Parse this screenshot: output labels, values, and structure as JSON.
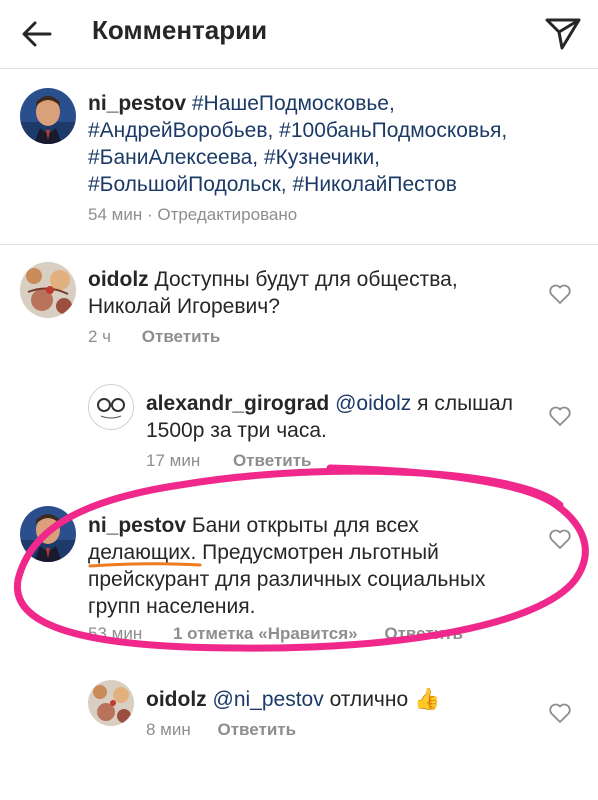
{
  "header": {
    "title": "Комментарии"
  },
  "caption": {
    "username": "ni_pestov",
    "lines": [
      [
        "#НашеПодмосковье,"
      ],
      [
        "#АндрейВоробьев,",
        "#100баньПодмосковья,"
      ],
      [
        "#БаниАлексеева,",
        "#Кузнечики,"
      ],
      [
        "#БольшойПодольск,",
        "#НиколайПестов"
      ]
    ],
    "time": "54 мин",
    "edited": "Отредактировано"
  },
  "comments": [
    {
      "username": "oidolz",
      "text_line1": "Доступны будут для общества,",
      "text_line2": "Николай Игоревич?",
      "time": "2 ч",
      "reply": "Ответить"
    },
    {
      "username": "alexandr_girograd",
      "mention": "@oidolz",
      "text_line1": "я слышал",
      "text_line2": "1500р за три часа.",
      "time": "17 мин",
      "reply": "Ответить"
    },
    {
      "username": "ni_pestov",
      "text_line1": "Бани открыты для всех",
      "text_word": "делающих",
      "text_line2": ". Предусмотрен льготный",
      "text_line3": "прейскурант для различных социальных",
      "text_line4": "групп населения.",
      "time": "53 мин",
      "likes": "1 отметка «Нравится»",
      "reply": "Ответить"
    },
    {
      "username": "oidolz",
      "mention": "@ni_pestov",
      "text": "отлично",
      "emoji": "👍",
      "time": "8 мин",
      "reply": "Ответить"
    }
  ],
  "colors": {
    "text": "#262626",
    "secondary": "#8e8e8e",
    "hashtag": "#1c3a66",
    "annotation_circle": "#f0288c",
    "annotation_underline": "#f07a1e"
  }
}
